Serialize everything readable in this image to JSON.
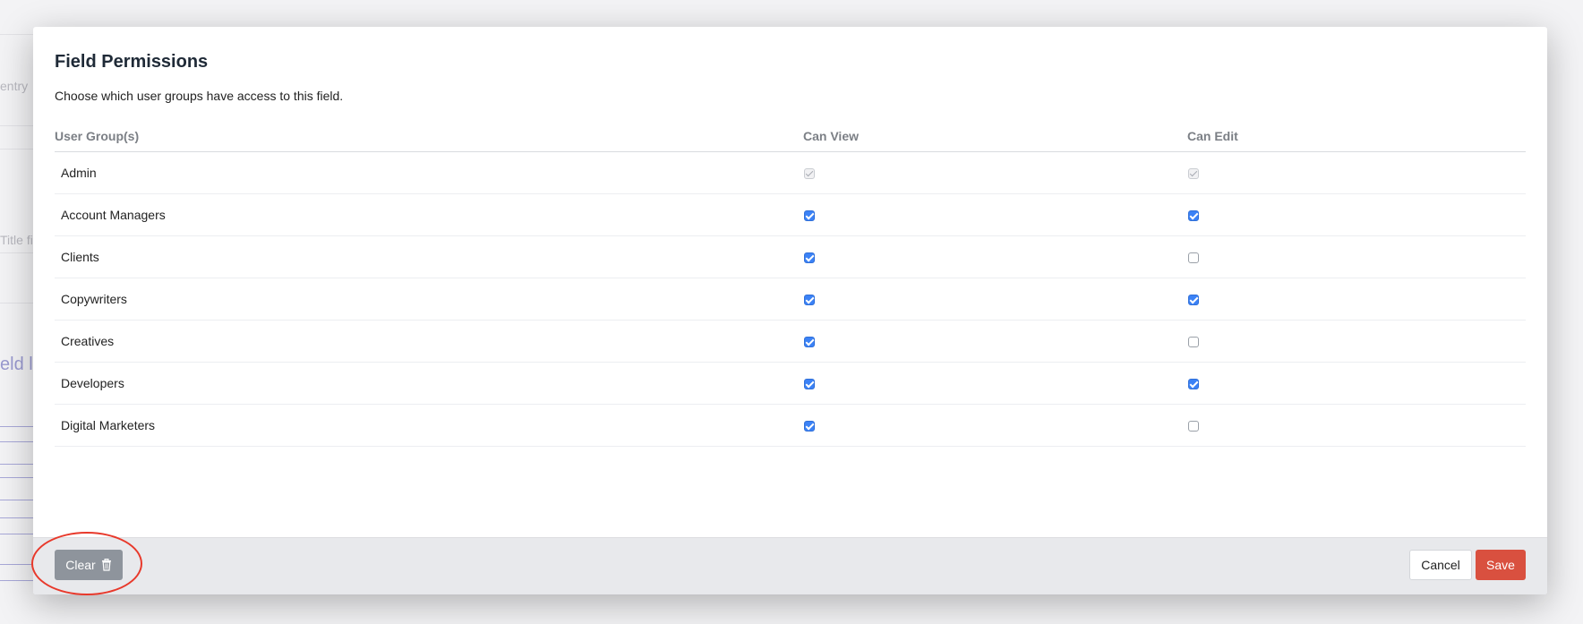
{
  "background": {
    "fragments": [
      "entry",
      "Title fi",
      "eld la"
    ]
  },
  "modal": {
    "title": "Field Permissions",
    "description": "Choose which user groups have access to this field.",
    "table": {
      "headers": [
        "User Group(s)",
        "Can View",
        "Can Edit"
      ],
      "rows": [
        {
          "group": "Admin",
          "can_view": "checked-disabled",
          "can_edit": "checked-disabled"
        },
        {
          "group": "Account Managers",
          "can_view": "checked",
          "can_edit": "checked"
        },
        {
          "group": "Clients",
          "can_view": "checked",
          "can_edit": "unchecked"
        },
        {
          "group": "Copywriters",
          "can_view": "checked",
          "can_edit": "checked"
        },
        {
          "group": "Creatives",
          "can_view": "checked",
          "can_edit": "unchecked"
        },
        {
          "group": "Developers",
          "can_view": "checked",
          "can_edit": "checked"
        },
        {
          "group": "Digital Marketers",
          "can_view": "checked",
          "can_edit": "unchecked"
        }
      ]
    },
    "footer": {
      "clear_label": "Clear",
      "clear_icon": "trash-icon",
      "cancel_label": "Cancel",
      "save_label": "Save"
    }
  },
  "colors": {
    "checkbox_accent": "#3b82f6",
    "save_button": "#d9503f",
    "clear_button": "#8e949c",
    "annotation": "#e8392b"
  }
}
